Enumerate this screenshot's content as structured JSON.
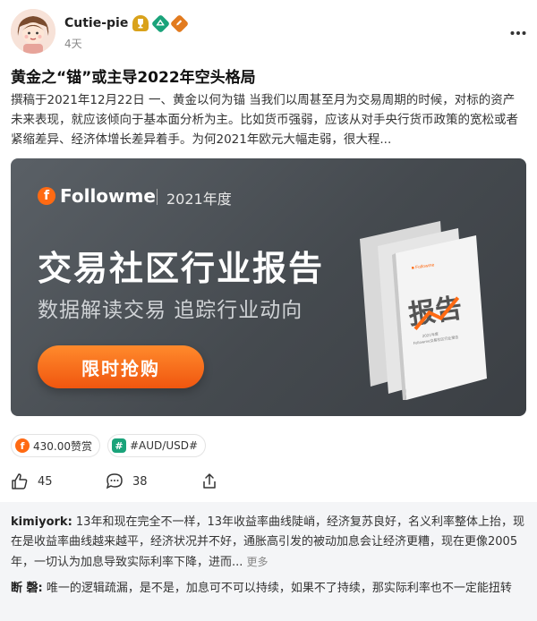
{
  "post": {
    "author": "Cutie-pie",
    "time": "4天",
    "badges": [
      "trophy-icon",
      "level-icon",
      "pen-icon"
    ],
    "title": "黄金之“锚”或主导2022年空头格局",
    "excerpt": "撰稿于2021年12月22日 一、黄金以何为锚 当我们以周甚至月为交易周期的时候，对标的资产未来表现，就应该倾向于基本面分析为主。比如货币强弱，应该从对手央行货币政策的宽松或者紧缩差异、经济体增长差异着手。为何2021年欧元大幅走弱，很大程..."
  },
  "banner": {
    "logo_mark": "f",
    "brand": "Followme",
    "year": "2021年度",
    "headline": "交易社区行业报告",
    "subline": "数据解读交易 追踪行业动向",
    "cta": "限时抢购",
    "book_title": "报告",
    "book_year": "2021年度",
    "book_sub": "Followme交易社区行业报告"
  },
  "tags": [
    {
      "icon": "coin-icon",
      "label": "430.00赞赏"
    },
    {
      "icon": "hashtag-icon",
      "label": "#AUD/USD#"
    }
  ],
  "actions": {
    "likes": "45",
    "comments": "38"
  },
  "comments": [
    {
      "user": "kimiyork:",
      "text": "13年和现在完全不一样，13年收益率曲线陡峭，经济复苏良好，名义利率整体上抬，现在是收益率曲线越来越平，经济状况并不好，通胀高引发的被动加息会让经济更糟，现在更像2005年，一切认为加息导致实际利率下降，进而...",
      "more": "更多"
    },
    {
      "user": "断 磬:",
      "text": "唯一的逻辑疏漏，是不是，加息可不可以持续，如果不了持续，那实际利率也不一定能扭转"
    }
  ],
  "colors": {
    "accent": "#ff6a13",
    "banner_bg": "#4b5055",
    "comment_bg": "#f4f5f7"
  }
}
